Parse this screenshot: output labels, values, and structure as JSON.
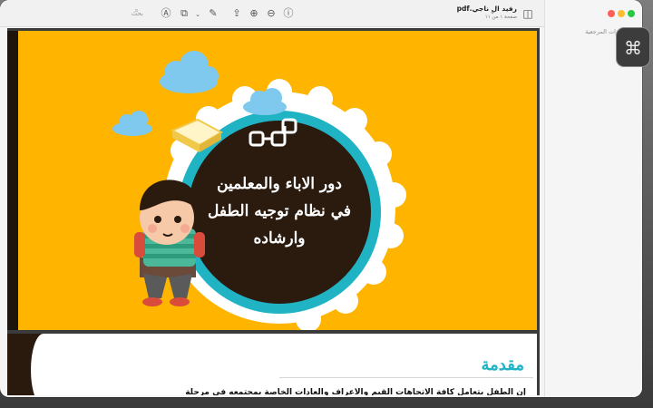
{
  "window": {
    "document_title": "رفيد ال ناجي.pdf",
    "document_subtitle": "صفحة ١ من ١١",
    "search_placeholder": "بحث"
  },
  "toolbar": {
    "icons": [
      "sidebar-toggle-icon",
      "info-icon",
      "zoom-out-icon",
      "zoom-in-icon",
      "share-icon",
      "markup-pen-icon",
      "rotate-icon",
      "annotate-icon",
      "search-icon"
    ]
  },
  "sidebar": {
    "label": "الإشارات المرجعية"
  },
  "page1": {
    "title_lines": [
      "دور الاباء والمعلمين",
      "في نظام توجيه الطفل",
      "وارشاده"
    ]
  },
  "page2": {
    "heading": "مقدمة",
    "text": "إن الطفل يتعامل كافة الاتجاهات القيم والأعراف والعادات الخاصة بمجتمعه في مرحلة"
  },
  "colors": {
    "page_background": "#ffb400",
    "circle_ring": "#1fb3c4",
    "circle_fill": "#2b1b0f",
    "heading": "#1fb3c4"
  }
}
